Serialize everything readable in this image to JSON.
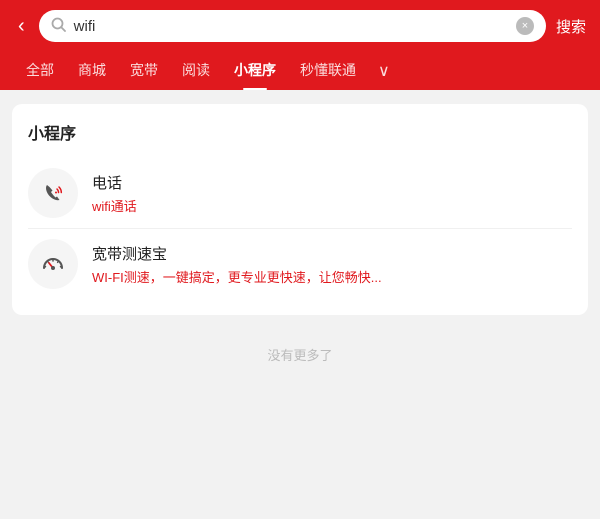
{
  "header": {
    "back_label": "‹",
    "search_value": "wifi",
    "clear_icon": "×",
    "search_btn": "搜索",
    "accent_color": "#e0191e"
  },
  "nav": {
    "tabs": [
      {
        "id": "all",
        "label": "全部",
        "active": false
      },
      {
        "id": "mall",
        "label": "商城",
        "active": false
      },
      {
        "id": "broadband",
        "label": "宽带",
        "active": false
      },
      {
        "id": "reading",
        "label": "阅读",
        "active": false
      },
      {
        "id": "mini",
        "label": "小程序",
        "active": true
      },
      {
        "id": "understand",
        "label": "秒懂联通",
        "active": false
      }
    ],
    "more_icon": "∨"
  },
  "section": {
    "title": "小程序",
    "items": [
      {
        "id": "phone",
        "title": "电话",
        "subtitle": "wifi通话"
      },
      {
        "id": "speedtest",
        "title": "宽带测速宝",
        "subtitle": "WI-FI测速，一键搞定，更专业更快速，让您畅快..."
      }
    ]
  },
  "footer": {
    "no_more": "没有更多了"
  }
}
